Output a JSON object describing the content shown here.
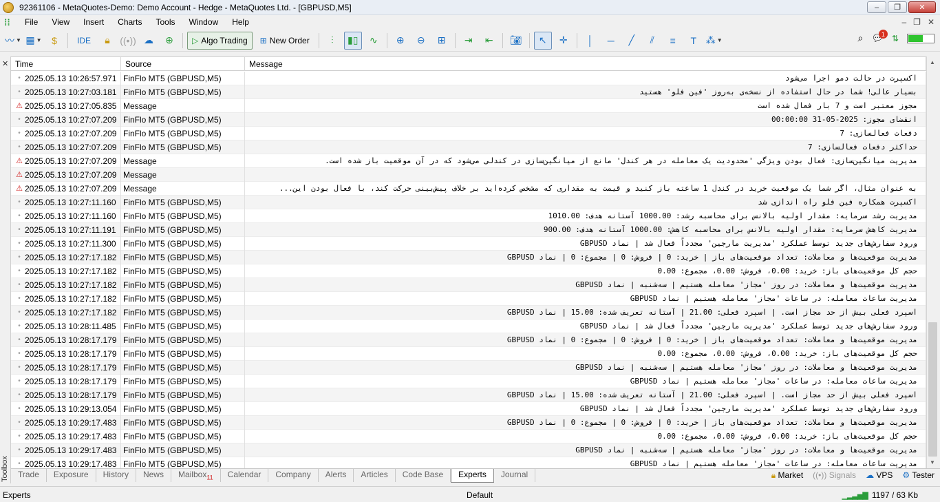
{
  "window": {
    "title": "92361106 - MetaQuotes-Demo: Demo Account - Hedge - MetaQuotes Ltd. - [GBPUSD,M5]",
    "controls": [
      "–",
      "❐",
      "✕"
    ]
  },
  "menu": {
    "items": [
      "File",
      "View",
      "Insert",
      "Charts",
      "Tools",
      "Window",
      "Help"
    ],
    "mdi_controls": [
      "–",
      "❐",
      "✕"
    ]
  },
  "toolbar": {
    "ide_label": "IDE",
    "algo_trading_label": "Algo Trading",
    "new_order_label": "New Order",
    "notification_count": "1",
    "connection_level": 0.55,
    "colors": {
      "accent": "#1a6fc4",
      "positive": "#2a9d3a",
      "warning": "#d01c1c"
    }
  },
  "grid": {
    "columns": [
      "Time",
      "Source",
      "Message"
    ],
    "rows": [
      {
        "icon": "dot",
        "time": "2025.05.13 10:26:57.971",
        "source": "FinFlo MT5 (GBPUSD,M5)",
        "message": "اکسپرت در حالت دمو اجرا می‌شود"
      },
      {
        "icon": "dot",
        "time": "2025.05.13 10:27:03.181",
        "source": "FinFlo MT5 (GBPUSD,M5)",
        "message": "بسیار عالی! شما در حال استفاده از نسخه‌ی به‌روز 'فین فلو' هستید"
      },
      {
        "icon": "warn",
        "time": "2025.05.13 10:27:05.835",
        "source": "Message",
        "message": "مجوز معتبر است و 7 بار فعال شده است"
      },
      {
        "icon": "dot",
        "time": "2025.05.13 10:27:07.209",
        "source": "FinFlo MT5 (GBPUSD,M5)",
        "message": "انقضای مجوز: 2025-05-31 00:00:00"
      },
      {
        "icon": "dot",
        "time": "2025.05.13 10:27:07.209",
        "source": "FinFlo MT5 (GBPUSD,M5)",
        "message": "دفعات فعالسازی: 7"
      },
      {
        "icon": "dot",
        "time": "2025.05.13 10:27:07.209",
        "source": "FinFlo MT5 (GBPUSD,M5)",
        "message": "حداکثر دفعات فعالسازی: 7"
      },
      {
        "icon": "warn",
        "time": "2025.05.13 10:27:07.209",
        "source": "Message",
        "message": "مدیریت میانگین‌سازی: فعال بودن ویژگی 'محدودیت یک معامله در هر کندل' مانع از میانگین‌سازی در کندلی می‌شود که در آن موقعیت باز شده است."
      },
      {
        "icon": "warn",
        "time": "2025.05.13 10:27:07.209",
        "source": "Message",
        "message": ""
      },
      {
        "icon": "warn",
        "time": "2025.05.13 10:27:07.209",
        "source": "Message",
        "message": "به عنوان مثال، اگر شما یک موقعیت خرید در کندل 1 ساعته باز کنید و قیمت به مقداری که مشخص کرده‌اید بر خلاف پیش‌بینی حرکت کند، با فعال بودن این..."
      },
      {
        "icon": "dot",
        "time": "2025.05.13 10:27:11.160",
        "source": "FinFlo MT5 (GBPUSD,M5)",
        "message": "اکسپرت همکاره فین فلو راه اندازی شد"
      },
      {
        "icon": "dot",
        "time": "2025.05.13 10:27:11.160",
        "source": "FinFlo MT5 (GBPUSD,M5)",
        "message": "مدیریت رشد سرمایه: مقدار اولیه بالانس برای محاسبه رشد: 1000.00 آستانه هدف: 1010.00"
      },
      {
        "icon": "dot",
        "time": "2025.05.13 10:27:11.191",
        "source": "FinFlo MT5 (GBPUSD,M5)",
        "message": "مدیریت کاهش سرمایه: مقدار اولیه بالانس برای محاسبه کاهش: 1000.00 آستانه هدف: 900.00"
      },
      {
        "icon": "dot",
        "time": "2025.05.13 10:27:11.300",
        "source": "FinFlo MT5 (GBPUSD,M5)",
        "message": "ورود سفارش‌های جدید توسط عملکرد 'مدیریت مارجین' مجدداً فعال شد | نماد GBPUSD"
      },
      {
        "icon": "dot",
        "time": "2025.05.13 10:27:17.182",
        "source": "FinFlo MT5 (GBPUSD,M5)",
        "message": "مدیریت موقعیت‌ها و معاملات: تعداد موقعیت‌های باز | خرید: 0 | فروش: 0 | مجموع: 0 | نماد GBPUSD"
      },
      {
        "icon": "dot",
        "time": "2025.05.13 10:27:17.182",
        "source": "FinFlo MT5 (GBPUSD,M5)",
        "message": "حجم کل موقعیت‌های باز: خرید: 0.00، فروش: 0.00، مجموع: 0.00"
      },
      {
        "icon": "dot",
        "time": "2025.05.13 10:27:17.182",
        "source": "FinFlo MT5 (GBPUSD,M5)",
        "message": "مدیریت موقعیت‌ها و معاملات: در روز 'مجاز' معامله هستیم | سه‌شنبه | نماد GBPUSD"
      },
      {
        "icon": "dot",
        "time": "2025.05.13 10:27:17.182",
        "source": "FinFlo MT5 (GBPUSD,M5)",
        "message": "مدیریت ساعات معامله: در ساعات 'مجاز' معامله هستیم | نماد GBPUSD"
      },
      {
        "icon": "dot",
        "time": "2025.05.13 10:27:17.182",
        "source": "FinFlo MT5 (GBPUSD,M5)",
        "message": "اسپرد فعلی بیش از حد مجاز است. | اسپرد فعلی: 21.00 | آستانه تعریف شده: 15.00 | نماد GBPUSD"
      },
      {
        "icon": "dot",
        "time": "2025.05.13 10:28:11.485",
        "source": "FinFlo MT5 (GBPUSD,M5)",
        "message": "ورود سفارش‌های جدید توسط عملکرد 'مدیریت مارجین' مجدداً فعال شد | نماد GBPUSD"
      },
      {
        "icon": "dot",
        "time": "2025.05.13 10:28:17.179",
        "source": "FinFlo MT5 (GBPUSD,M5)",
        "message": "مدیریت موقعیت‌ها و معاملات: تعداد موقعیت‌های باز | خرید: 0 | فروش: 0 | مجموع: 0 | نماد GBPUSD"
      },
      {
        "icon": "dot",
        "time": "2025.05.13 10:28:17.179",
        "source": "FinFlo MT5 (GBPUSD,M5)",
        "message": "حجم کل موقعیت‌های باز: خرید: 0.00، فروش: 0.00، مجموع: 0.00"
      },
      {
        "icon": "dot",
        "time": "2025.05.13 10:28:17.179",
        "source": "FinFlo MT5 (GBPUSD,M5)",
        "message": "مدیریت موقعیت‌ها و معاملات: در روز 'مجاز' معامله هستیم | سه‌شنبه | نماد GBPUSD"
      },
      {
        "icon": "dot",
        "time": "2025.05.13 10:28:17.179",
        "source": "FinFlo MT5 (GBPUSD,M5)",
        "message": "مدیریت ساعات معامله: در ساعات 'مجاز' معامله هستیم | نماد GBPUSD"
      },
      {
        "icon": "dot",
        "time": "2025.05.13 10:28:17.179",
        "source": "FinFlo MT5 (GBPUSD,M5)",
        "message": "اسپرد فعلی بیش از حد مجاز است. | اسپرد فعلی: 21.00 | آستانه تعریف شده: 15.00 | نماد GBPUSD"
      },
      {
        "icon": "dot",
        "time": "2025.05.13 10:29:13.054",
        "source": "FinFlo MT5 (GBPUSD,M5)",
        "message": "ورود سفارش‌های جدید توسط عملکرد 'مدیریت مارجین' مجدداً فعال شد | نماد GBPUSD"
      },
      {
        "icon": "dot",
        "time": "2025.05.13 10:29:17.483",
        "source": "FinFlo MT5 (GBPUSD,M5)",
        "message": "مدیریت موقعیت‌ها و معاملات: تعداد موقعیت‌های باز | خرید: 0 | فروش: 0 | مجموع: 0 | نماد GBPUSD"
      },
      {
        "icon": "dot",
        "time": "2025.05.13 10:29:17.483",
        "source": "FinFlo MT5 (GBPUSD,M5)",
        "message": "حجم کل موقعیت‌های باز: خرید: 0.00، فروش: 0.00، مجموع: 0.00"
      },
      {
        "icon": "dot",
        "time": "2025.05.13 10:29:17.483",
        "source": "FinFlo MT5 (GBPUSD,M5)",
        "message": "مدیریت موقعیت‌ها و معاملات: در روز 'مجاز' معامله هستیم | سه‌شنبه | نماد GBPUSD"
      },
      {
        "icon": "dot",
        "time": "2025.05.13 10:29:17.483",
        "source": "FinFlo MT5 (GBPUSD,M5)",
        "message": "مدیریت ساعات معامله: در ساعات 'مجاز' معامله هستیم | نماد GBPUSD"
      }
    ]
  },
  "toolbox_label": "Toolbox",
  "tabs": {
    "items": [
      "Trade",
      "Exposure",
      "History",
      "News",
      "Mailbox",
      "Calendar",
      "Company",
      "Alerts",
      "Articles",
      "Code Base",
      "Experts",
      "Journal"
    ],
    "mailbox_count": "11",
    "active": "Experts",
    "right": [
      "Market",
      "Signals",
      "VPS",
      "Tester"
    ]
  },
  "status": {
    "left": "Experts",
    "profile": "Default",
    "traffic": "1197 / 63 Kb"
  }
}
